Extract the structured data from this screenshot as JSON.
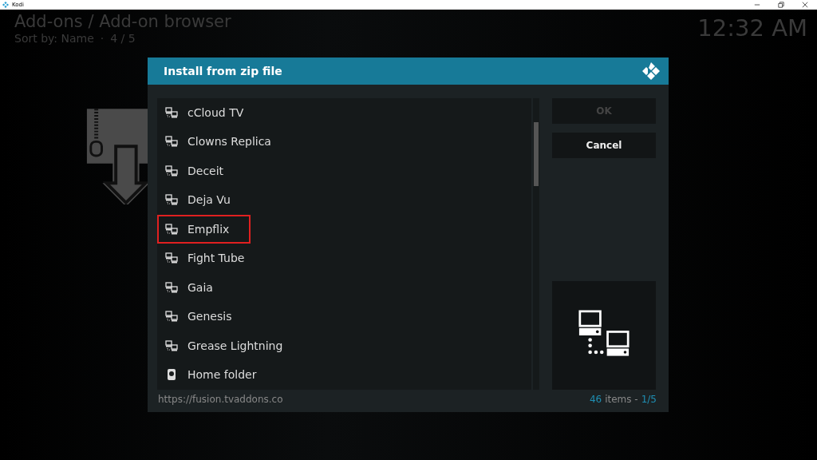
{
  "window": {
    "title": "Kodi"
  },
  "header": {
    "breadcrumb": "Add-ons / Add-on browser",
    "sort": "Sort by: Name",
    "separator": "·",
    "page": "4 / 5",
    "clock": "12:32 AM"
  },
  "dialog": {
    "title": "Install from zip file",
    "items": [
      {
        "label": "cCloud TV",
        "kind": "network",
        "selected": false
      },
      {
        "label": "Clowns Replica",
        "kind": "network",
        "selected": false
      },
      {
        "label": "Deceit",
        "kind": "network",
        "selected": false
      },
      {
        "label": "Deja Vu",
        "kind": "network",
        "selected": false
      },
      {
        "label": "Empflix",
        "kind": "network",
        "selected": true
      },
      {
        "label": "Fight Tube",
        "kind": "network",
        "selected": false
      },
      {
        "label": "Gaia",
        "kind": "network",
        "selected": false
      },
      {
        "label": "Genesis",
        "kind": "network",
        "selected": false
      },
      {
        "label": "Grease Lightning",
        "kind": "network",
        "selected": false
      },
      {
        "label": "Home folder",
        "kind": "drive",
        "selected": false
      }
    ],
    "buttons": [
      {
        "label": "OK",
        "disabled": true
      },
      {
        "label": "Cancel",
        "disabled": false
      }
    ],
    "path": "https://fusion.tvaddons.co",
    "count": "46",
    "count_label": "items -",
    "pages": "1/5"
  }
}
